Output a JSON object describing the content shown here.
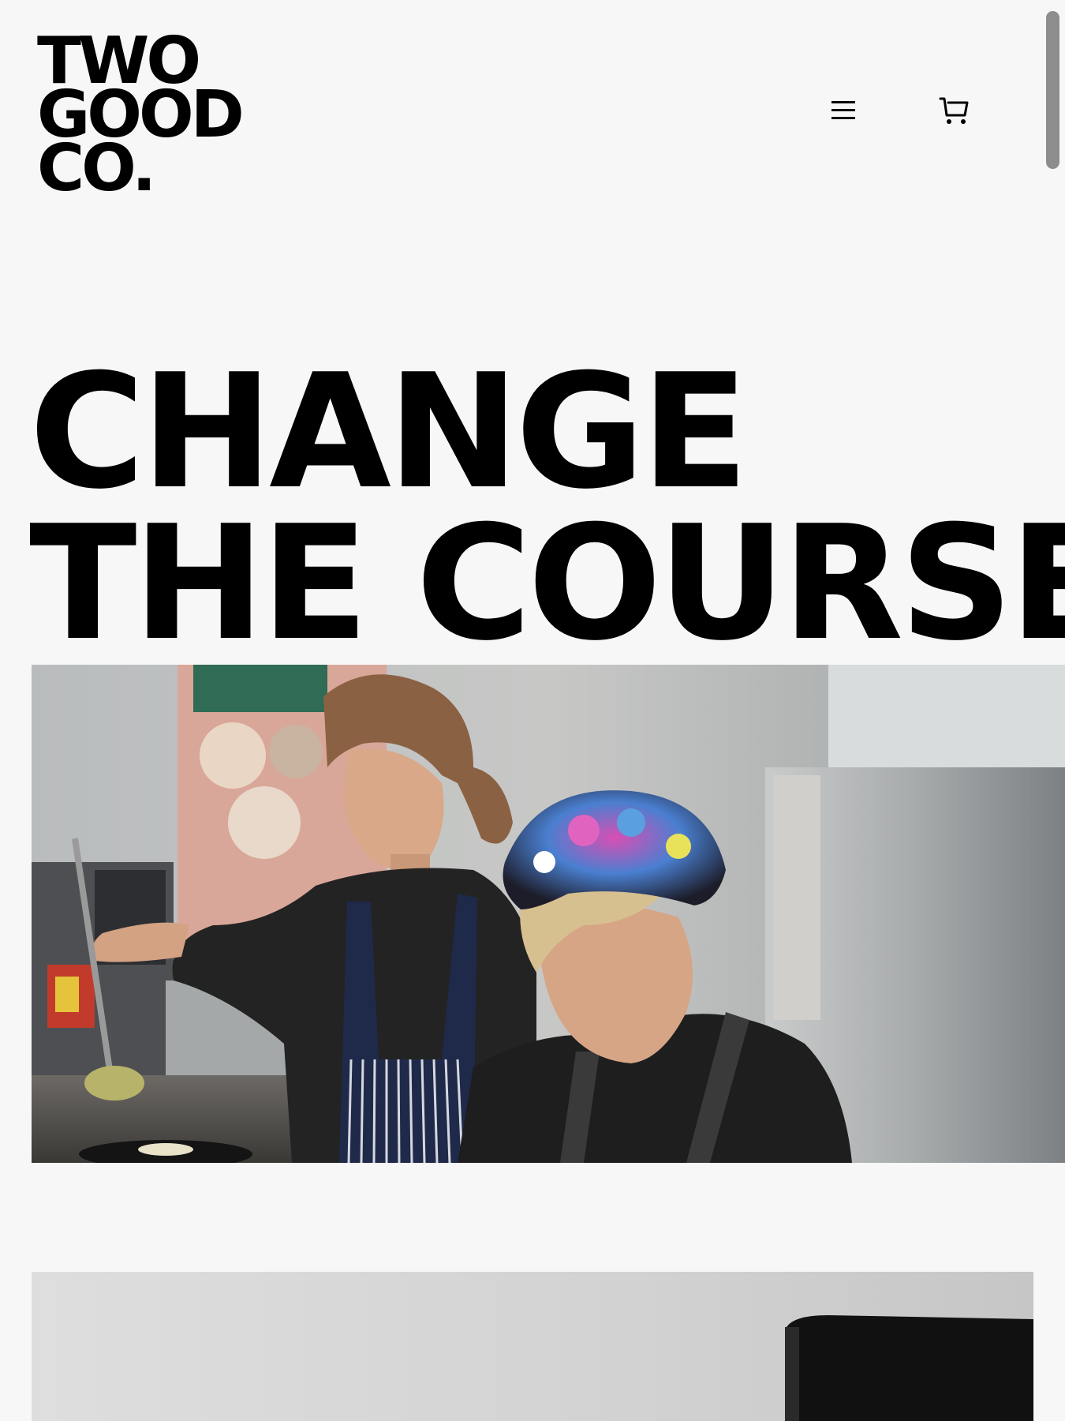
{
  "header": {
    "logo_lines": [
      "TWO",
      "GOOD",
      "CO."
    ],
    "menu_icon": "hamburger-menu-icon",
    "cart_icon": "shopping-cart-icon"
  },
  "hero": {
    "title_lines": [
      "CHANGE",
      "THE COURSE"
    ]
  },
  "colors": {
    "background": "#f7f7f7",
    "text": "#000000",
    "scrollbar_thumb": "#8d8d8d"
  }
}
